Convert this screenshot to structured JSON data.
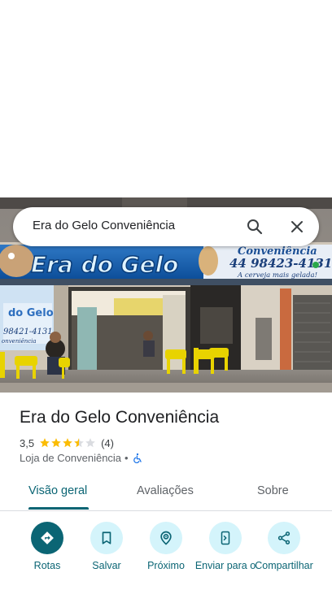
{
  "search": {
    "query": "Era do Gelo Conveniência"
  },
  "photo": {
    "sign_name": "Era do Gelo",
    "sign_brand": "Conveniência",
    "sign_phone": "44 98423-4131",
    "sign_slogan": "A cerveja mais gelada!",
    "left_sign_text": "do Gelo",
    "left_sign_phone": "98421-4131",
    "left_sign_small": "onveniência"
  },
  "place": {
    "name": "Era do Gelo Conveniência",
    "rating": "3,5",
    "rating_value": 3.5,
    "review_count": "(4)",
    "category": "Loja de Conveniência",
    "separator": "•",
    "accessibility_icon": "wheelchair-icon"
  },
  "tabs": [
    {
      "label": "Visão geral",
      "active": true
    },
    {
      "label": "Avaliações",
      "active": false
    },
    {
      "label": "Sobre",
      "active": false
    }
  ],
  "actions": [
    {
      "label": "Rotas",
      "icon": "directions-icon"
    },
    {
      "label": "Salvar",
      "icon": "bookmark-icon"
    },
    {
      "label": "Próximo",
      "icon": "nearby-icon"
    },
    {
      "label": "Enviar para o",
      "icon": "send-to-phone-icon"
    },
    {
      "label": "Compartilhar",
      "icon": "share-icon"
    }
  ],
  "colors": {
    "accent": "#0b6574",
    "action_bg": "#d4f4fb",
    "star": "#fbbc04",
    "star_empty": "#dadce0"
  }
}
